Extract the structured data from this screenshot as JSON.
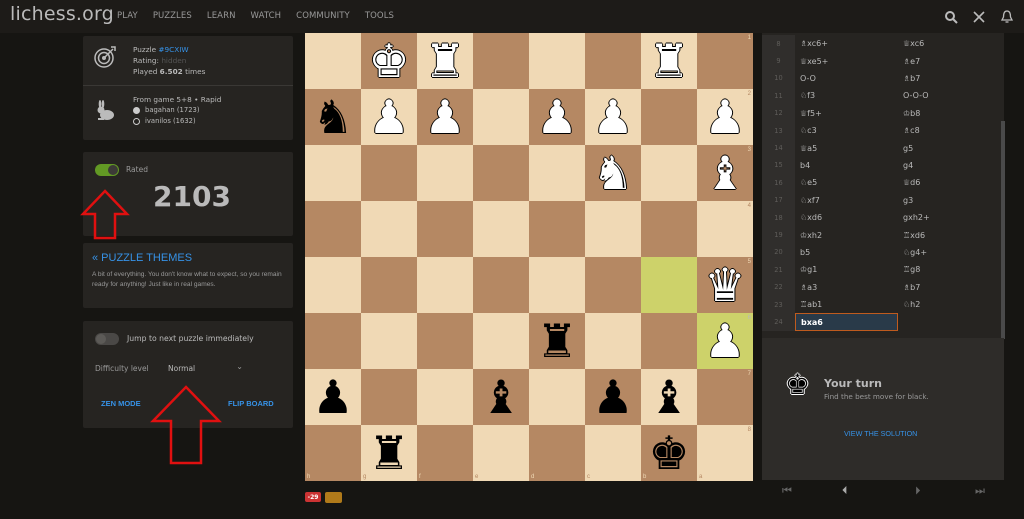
{
  "header": {
    "logo": "lichess.org",
    "nav": [
      "PLAY",
      "PUZZLES",
      "LEARN",
      "WATCH",
      "COMMUNITY",
      "TOOLS"
    ],
    "icons": [
      "search-icon",
      "swords-icon",
      "bell-icon"
    ]
  },
  "puzzle_info": {
    "puzzle_label": "Puzzle ",
    "puzzle_id": "#9CXIW",
    "rating_label": "Rating: ",
    "rating_value": "hidden",
    "played_prefix": "Played ",
    "played_count": "6.502",
    "played_suffix": " times",
    "game_label": "From game 5+8 • Rapid",
    "white_player": "bagahan (1723)",
    "black_player": "ivanilos (1632)"
  },
  "rated": {
    "label": "Rated",
    "enabled": true,
    "rating": "2103"
  },
  "themes": {
    "title": "« PUZZLE THEMES",
    "description": "A bit of everything. You don't know what to expect, so you remain ready for anything! Just like in real games."
  },
  "settings": {
    "jump_label": "Jump to next puzzle immediately",
    "jump_enabled": false,
    "difficulty_label": "Difficulty level",
    "difficulty_value": "Normal",
    "zen_mode": "ZEN MODE",
    "flip_board": "FLIP BOARD"
  },
  "board": {
    "orientation": "black",
    "ranks": [
      "1",
      "2",
      "3",
      "4",
      "5",
      "6",
      "7",
      "8"
    ],
    "files": [
      "h",
      "g",
      "f",
      "e",
      "d",
      "c",
      "b",
      "a"
    ],
    "pieces": [
      {
        "sq": "g1",
        "color": "w",
        "type": "king",
        "glyph": "♚"
      },
      {
        "sq": "f1",
        "color": "w",
        "type": "rook",
        "glyph": "♜"
      },
      {
        "sq": "b1",
        "color": "w",
        "type": "rook",
        "glyph": "♜"
      },
      {
        "sq": "h2",
        "color": "b",
        "type": "knight",
        "glyph": "♞"
      },
      {
        "sq": "g2",
        "color": "w",
        "type": "pawn",
        "glyph": "♟"
      },
      {
        "sq": "f2",
        "color": "w",
        "type": "pawn",
        "glyph": "♟"
      },
      {
        "sq": "d2",
        "color": "w",
        "type": "pawn",
        "glyph": "♟"
      },
      {
        "sq": "c2",
        "color": "w",
        "type": "pawn",
        "glyph": "♟"
      },
      {
        "sq": "a2",
        "color": "w",
        "type": "pawn",
        "glyph": "♟"
      },
      {
        "sq": "c3",
        "color": "w",
        "type": "knight",
        "glyph": "♞"
      },
      {
        "sq": "a3",
        "color": "w",
        "type": "bishop",
        "glyph": "♝"
      },
      {
        "sq": "a5",
        "color": "w",
        "type": "queen",
        "glyph": "♛"
      },
      {
        "sq": "a6",
        "color": "w",
        "type": "pawn",
        "glyph": "♟"
      },
      {
        "sq": "d6",
        "color": "b",
        "type": "rook",
        "glyph": "♜"
      },
      {
        "sq": "h7",
        "color": "b",
        "type": "pawn",
        "glyph": "♟"
      },
      {
        "sq": "e7",
        "color": "b",
        "type": "bishop",
        "glyph": "♝"
      },
      {
        "sq": "c7",
        "color": "b",
        "type": "pawn",
        "glyph": "♟"
      },
      {
        "sq": "b7",
        "color": "b",
        "type": "bishop",
        "glyph": "♝"
      },
      {
        "sq": "g8",
        "color": "b",
        "type": "rook",
        "glyph": "♜"
      },
      {
        "sq": "b8",
        "color": "b",
        "type": "king",
        "glyph": "♚"
      }
    ],
    "last_move": [
      "b5",
      "a6"
    ],
    "material_diff": "-29"
  },
  "moves": [
    {
      "n": "8",
      "w": "♗xc6+",
      "b": "♕xc6"
    },
    {
      "n": "9",
      "w": "♕xe5+",
      "b": "♗e7"
    },
    {
      "n": "10",
      "w": "O-O",
      "b": "♗b7"
    },
    {
      "n": "11",
      "w": "♘f3",
      "b": "O-O-O"
    },
    {
      "n": "12",
      "w": "♕f5+",
      "b": "♔b8"
    },
    {
      "n": "13",
      "w": "♘c3",
      "b": "♗c8"
    },
    {
      "n": "14",
      "w": "♕a5",
      "b": "g5"
    },
    {
      "n": "15",
      "w": "b4",
      "b": "g4"
    },
    {
      "n": "16",
      "w": "♘e5",
      "b": "♕d6"
    },
    {
      "n": "17",
      "w": "♘xf7",
      "b": "g3"
    },
    {
      "n": "18",
      "w": "♘xd6",
      "b": "gxh2+"
    },
    {
      "n": "19",
      "w": "♔xh2",
      "b": "♖xd6"
    },
    {
      "n": "20",
      "w": "b5",
      "b": "♘g4+"
    },
    {
      "n": "21",
      "w": "♔g1",
      "b": "♖g8"
    },
    {
      "n": "22",
      "w": "♗a3",
      "b": "♗b7"
    },
    {
      "n": "23",
      "w": "♖ab1",
      "b": "♘h2"
    },
    {
      "n": "24",
      "w": "bxa6",
      "b": ""
    }
  ],
  "turn": {
    "title": "Your turn",
    "subtitle": "Find the best move for black.",
    "solution": "VIEW THE SOLUTION"
  },
  "controls": [
    "first-move-icon",
    "previous-move-icon",
    "next-move-icon",
    "last-move-icon"
  ]
}
